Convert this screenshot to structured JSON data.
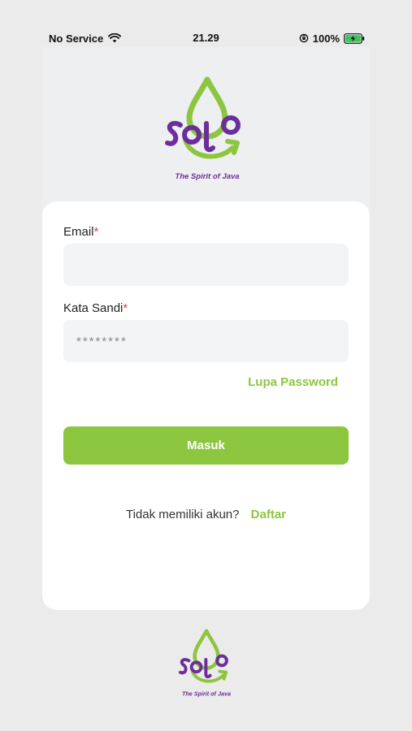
{
  "status_bar": {
    "carrier": "No Service",
    "time": "21.29",
    "battery": "100%"
  },
  "brand": {
    "logo_text": "solo",
    "tagline": "The Spirit of Java",
    "colors": {
      "purple": "#6b2e9a",
      "green": "#8cc63f"
    }
  },
  "form": {
    "email_label": "Email",
    "email_value": "",
    "password_label": "Kata Sandi",
    "password_placeholder": "********",
    "required_mark": "*",
    "forgot_label": "Lupa Password",
    "submit_label": "Masuk"
  },
  "register": {
    "prompt": "Tidak memiliki akun?",
    "link_label": "Daftar"
  },
  "colors": {
    "accent": "#8cc63f",
    "required": "#e53935"
  }
}
